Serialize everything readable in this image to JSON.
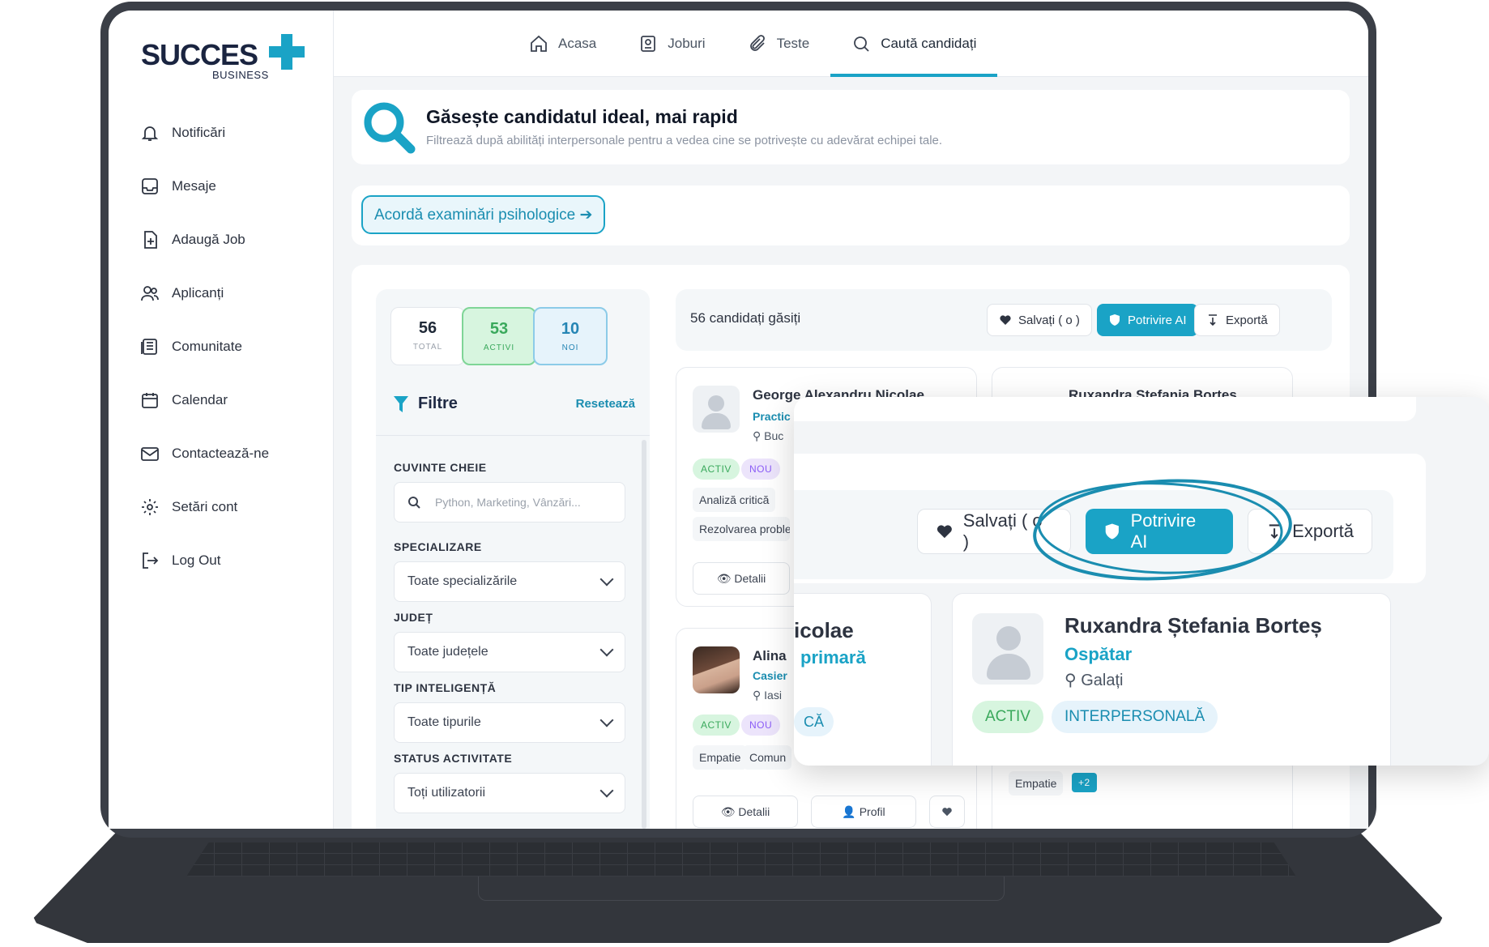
{
  "brand": {
    "name": "SUCCES",
    "sub": "BUSINESS",
    "accent": "#1aa3c6"
  },
  "sidebar": {
    "items": [
      {
        "label": "Notificări",
        "icon": "bell-icon"
      },
      {
        "label": "Mesaje",
        "icon": "inbox-icon"
      },
      {
        "label": "Adaugă Job",
        "icon": "add-job-icon"
      },
      {
        "label": "Aplicanți",
        "icon": "users-icon"
      },
      {
        "label": "Comunitate",
        "icon": "newspaper-icon"
      },
      {
        "label": "Calendar",
        "icon": "calendar-icon"
      },
      {
        "label": "Contactează-ne",
        "icon": "mail-icon"
      },
      {
        "label": "Setări cont",
        "icon": "gear-icon"
      },
      {
        "label": "Log Out",
        "icon": "logout-icon"
      }
    ]
  },
  "topnav": {
    "tabs": [
      {
        "label": "Acasa",
        "icon": "home-icon"
      },
      {
        "label": "Joburi",
        "icon": "id-card-icon"
      },
      {
        "label": "Teste",
        "icon": "paperclip-icon"
      },
      {
        "label": "Caută candidați",
        "icon": "search-icon",
        "active": true
      }
    ]
  },
  "hero": {
    "title": "Găsește candidatul ideal, mai rapid",
    "subtitle": "Filtrează după abilități interpersonale pentru a vedea cine se potrivește cu adevărat echipei tale."
  },
  "exam": {
    "label": "Acordă examinări psihologice ➔"
  },
  "stats": [
    {
      "value": "56",
      "label": "TOTAL"
    },
    {
      "value": "53",
      "label": "ACTIVI"
    },
    {
      "value": "10",
      "label": "NOI"
    }
  ],
  "filters": {
    "title": "Filtre",
    "reset": "Resetează",
    "keywords_label": "CUVINTE CHEIE",
    "keywords_placeholder": "Python, Marketing, Vânzări...",
    "spec_label": "SPECIALIZARE",
    "spec_value": "Toate specializările",
    "county_label": "JUDEȚ",
    "county_value": "Toate județele",
    "intel_label": "TIP INTELIGENȚĂ",
    "intel_value": "Toate tipurile",
    "status_label": "STATUS ACTIVITATE",
    "status_value": "Toți utilizatorii"
  },
  "results": {
    "count": "56 candidați găsiți",
    "saved": "Salvați ( o )",
    "ai": "Potrivire AI",
    "export": "Exportă"
  },
  "candidates": [
    {
      "name": "George Alexandru Nicolae",
      "role": "Practic",
      "location": "Buc",
      "badges": [
        "ACTIV",
        "NOU"
      ],
      "skills": [
        "Analiză critică",
        "Rezolvarea proble"
      ],
      "details": "Detalii"
    },
    {
      "name": "Ruxandra Stefania Bortes",
      "skills": [
        "Empatie"
      ],
      "more": "+2"
    },
    {
      "name": "Alina",
      "role": "Casier",
      "location": "Iasi",
      "badges": [
        "ACTIV",
        "NOU"
      ],
      "skills": [
        "Empatie",
        "Comun"
      ],
      "details": "Detalii",
      "profile": "Profil"
    }
  ],
  "zoom": {
    "saved": "Salvați ( o )",
    "ai": "Potrivire AI",
    "export": "Exportă",
    "left_name": "icolae",
    "left_role": "primară",
    "left_badge": "CĂ",
    "name": "Ruxandra Ștefania Borteș",
    "role": "Ospătar",
    "location": "Galați",
    "badges": [
      "ACTIV",
      "INTERPERSONALĂ"
    ]
  }
}
